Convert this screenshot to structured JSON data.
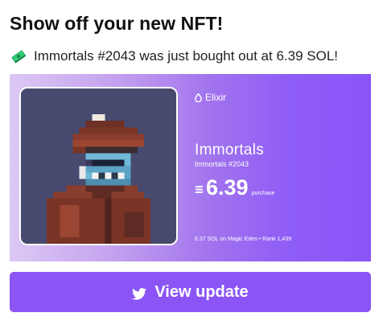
{
  "header": {
    "title": "Show off your new NFT!",
    "subtitle": "Immortals #2043 was just bought out at 6.39 SOL!",
    "subtitle_icon": "money-stack-icon"
  },
  "card": {
    "brand": "Elixir",
    "brand_icon": "elixir-drop-icon",
    "collection": "Immortals",
    "nft_id": "Immortals #2043",
    "price_icon": "solana-icon",
    "price": "6.39",
    "price_label": "purchase",
    "meta": "6.37 SOL on Magic Eden • Rank 1,439",
    "gradient": [
      "#dcc8f4",
      "#8a55f8"
    ]
  },
  "cta": {
    "label": "View update",
    "icon": "twitter-bird-icon",
    "color": "#8a55f4"
  }
}
